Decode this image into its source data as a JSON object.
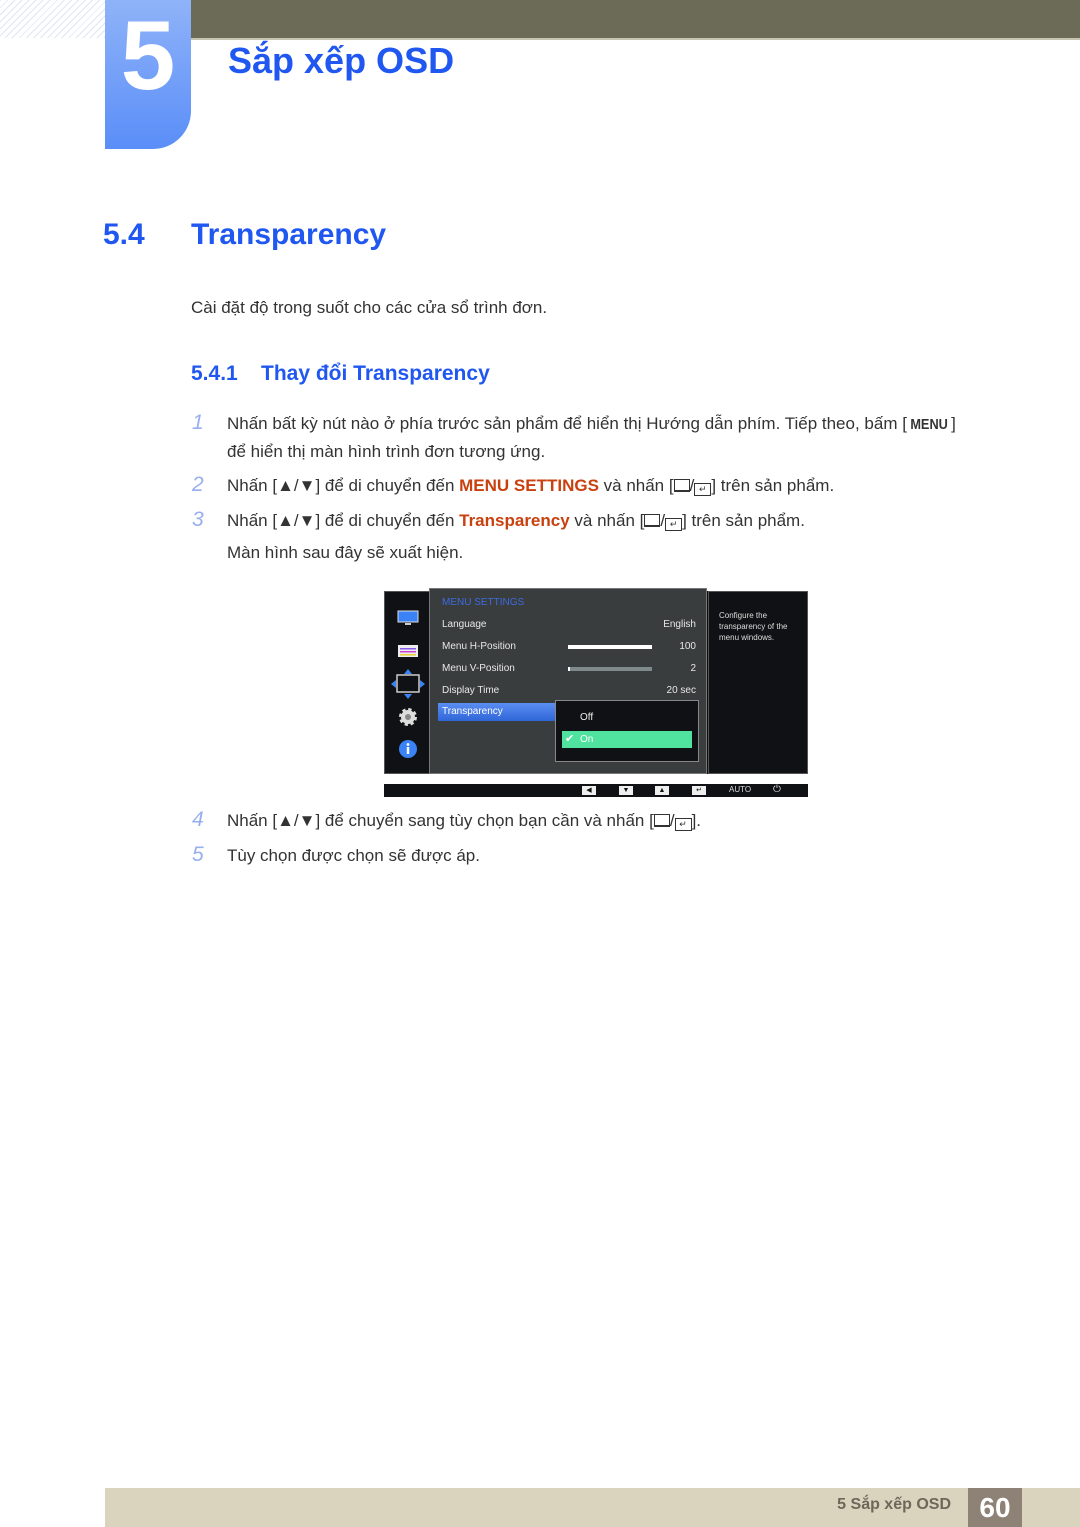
{
  "chapter": {
    "number": "5",
    "title": "Sắp xếp OSD"
  },
  "section": {
    "number": "5.4",
    "title": "Transparency",
    "intro": "Cài đặt độ trong suốt cho các cửa sổ trình đơn."
  },
  "subsection": {
    "number": "5.4.1",
    "title": "Thay đổi Transparency"
  },
  "steps": [
    {
      "num": "1",
      "line1_pre": "Nhấn bất kỳ nút nào ở phía trước sản phẩm để hiển thị Hướng dẫn phím. Tiếp theo, bấm [",
      "key": "MENU",
      "line1_post": "]",
      "line2": "để hiển thị màn hình trình đơn tương ứng."
    },
    {
      "num": "2",
      "pre": "Nhấn [▲/▼] để di chuyển đến ",
      "em": "MENU SETTINGS",
      "mid": " và nhấn [",
      "post": "] trên sản phẩm."
    },
    {
      "num": "3",
      "pre": "Nhấn [▲/▼] để di chuyển đến ",
      "em": "Transparency",
      "mid": " và nhấn [",
      "post": "] trên sản phẩm.",
      "line2": "Màn hình sau đây sẽ xuất hiện."
    },
    {
      "num": "4",
      "pre": "Nhấn [▲/▼] để chuyển sang tùy chọn bạn cần và nhấn [",
      "post": "]."
    },
    {
      "num": "5",
      "text": "Tùy chọn được chọn sẽ được áp."
    }
  ],
  "osd": {
    "title": "MENU SETTINGS",
    "rows": [
      {
        "label": "Language",
        "value": "English"
      },
      {
        "label": "Menu H-Position",
        "value": "100",
        "bar": 1.0
      },
      {
        "label": "Menu V-Position",
        "value": "2",
        "bar": 0.02
      },
      {
        "label": "Display Time",
        "value": "20 sec"
      }
    ],
    "selected": "Transparency",
    "options": [
      {
        "label": "Off",
        "checked": false
      },
      {
        "label": "On",
        "checked": true
      }
    ],
    "help": "Configure the transparency of the menu windows.",
    "side_icons": [
      "picture-icon",
      "color-icon",
      "size-position-icon",
      "setup-gear-icon",
      "information-icon"
    ],
    "keys": {
      "left": "◀",
      "down": "▼",
      "up": "▲",
      "enter": "↵",
      "auto": "AUTO",
      "power": "⏻"
    }
  },
  "footer": {
    "title": "5 Sắp xếp OSD",
    "page": "60"
  }
}
